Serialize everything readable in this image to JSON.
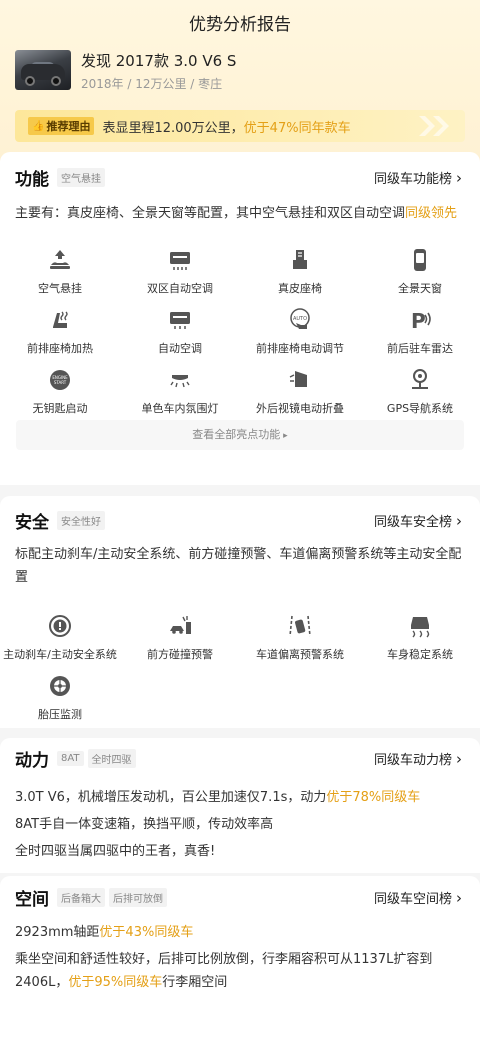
{
  "header": {
    "title": "优势分析报告"
  },
  "car": {
    "name": "发现 2017款 3.0 V6 S",
    "meta": "2018年 / 12万公里 / 枣庄"
  },
  "banner": {
    "badge": "推荐理由",
    "text": "表显里程12.00万公里，",
    "highlight": "优于47%同年款车"
  },
  "features": {
    "title": "功能",
    "tag": "空气悬挂",
    "rank": "同级车功能榜",
    "desc": "主要有：真皮座椅、全景天窗等配置，其中空气悬挂和双区自动空调",
    "desc_hl": "同级领先",
    "items": [
      {
        "label": "空气悬挂",
        "icon": "air-suspension-icon"
      },
      {
        "label": "双区自动空调",
        "icon": "dual-zone-ac-icon"
      },
      {
        "label": "真皮座椅",
        "icon": "leather-seat-icon"
      },
      {
        "label": "全景天窗",
        "icon": "panoramic-sunroof-icon"
      },
      {
        "label": "前排座椅加热",
        "icon": "seat-heating-icon"
      },
      {
        "label": "自动空调",
        "icon": "auto-ac-icon"
      },
      {
        "label": "前排座椅电动调节",
        "icon": "power-seat-icon"
      },
      {
        "label": "前后驻车雷达",
        "icon": "parking-radar-icon"
      },
      {
        "label": "无钥匙启动",
        "icon": "keyless-start-icon"
      },
      {
        "label": "单色车内氛围灯",
        "icon": "ambient-light-icon"
      },
      {
        "label": "外后视镜电动折叠",
        "icon": "mirror-fold-icon"
      },
      {
        "label": "GPS导航系统",
        "icon": "gps-icon"
      }
    ],
    "more": "查看全部亮点功能"
  },
  "safety": {
    "title": "安全",
    "tag": "安全性好",
    "rank": "同级车安全榜",
    "desc": "标配主动刹车/主动安全系统、前方碰撞预警、车道偏离预警系统等主动安全配置",
    "items": [
      {
        "label": "主动刹车/主动安全系统",
        "icon": "active-brake-icon"
      },
      {
        "label": "前方碰撞预警",
        "icon": "collision-warning-icon"
      },
      {
        "label": "车道偏离预警系统",
        "icon": "lane-departure-icon"
      },
      {
        "label": "车身稳定系统",
        "icon": "stability-control-icon"
      },
      {
        "label": "胎压监测",
        "icon": "tire-pressure-icon"
      }
    ]
  },
  "power": {
    "title": "动力",
    "tags": [
      "8AT",
      "全时四驱"
    ],
    "rank": "同级车动力榜",
    "line1": "3.0T V6，机械增压发动机，百公里加速仅7.1s，动力",
    "line1_hl": "优于78%同级车",
    "line2": "8AT手自一体变速箱，换挡平顺，传动效率高",
    "line3": "全时四驱当属四驱中的王者，真香!"
  },
  "space": {
    "title": "空间",
    "tags": [
      "后备箱大",
      "后排可放倒"
    ],
    "rank": "同级车空间榜",
    "line1": "2923mm轴距",
    "line1_hl": "优于43%同级车",
    "line2a": "乘坐空间和舒适性较好，后排可比例放倒，行李厢容积可从1137L扩容到2406L，",
    "line2_hl": "优于95%同级车",
    "line2b": "行李厢空间"
  },
  "colors": {
    "accent": "#e4a017",
    "badge": "#f6c94a",
    "banner": "#fde79a"
  }
}
